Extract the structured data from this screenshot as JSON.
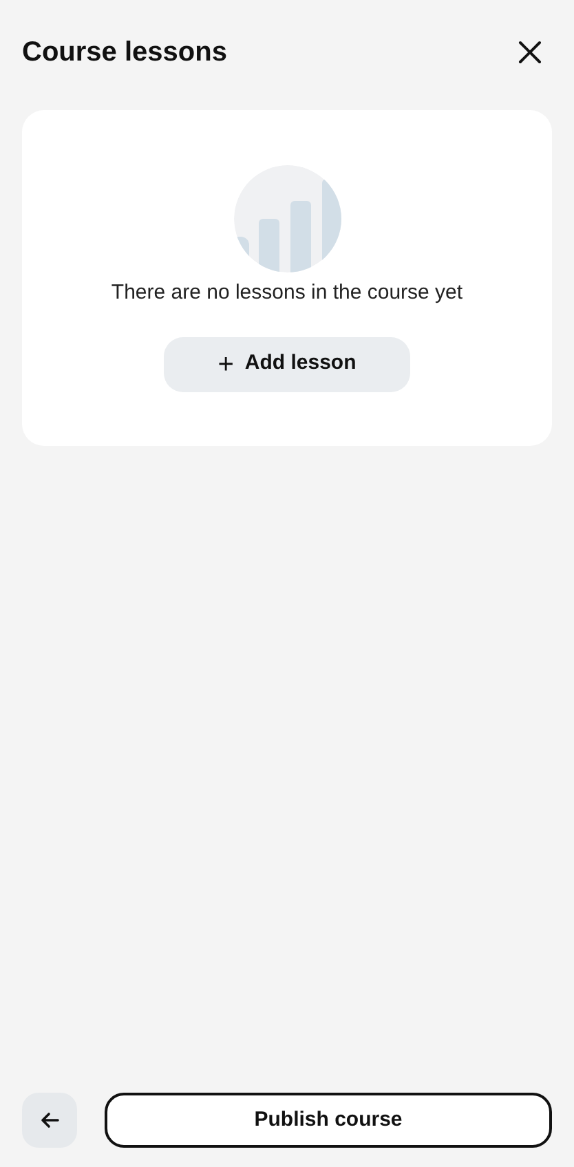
{
  "header": {
    "title": "Course lessons"
  },
  "empty_state": {
    "message": "There are no lessons in the course yet",
    "button": {
      "icon": "+",
      "label": "Add lesson"
    }
  },
  "footer": {
    "primary_button": "Publish course"
  }
}
